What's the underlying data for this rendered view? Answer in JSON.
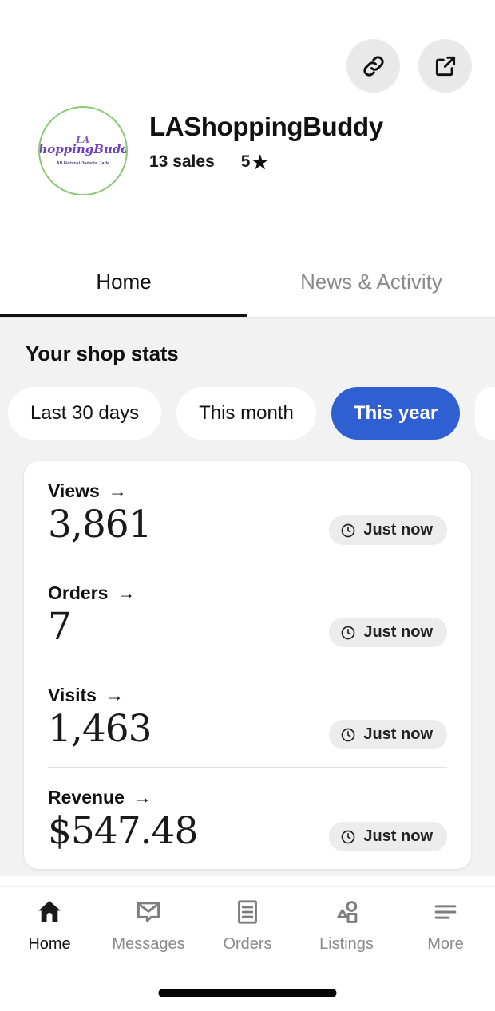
{
  "header": {
    "actions": [
      {
        "name": "link-icon",
        "label": "Copy shop link"
      },
      {
        "name": "external-link-icon",
        "label": "Open shop"
      }
    ],
    "logo": {
      "top_text": "LA",
      "name_text": "ShoppingBuddy",
      "sub_text": "All Natural Jadeite Jade",
      "border_color": "#8cc878",
      "text_color": "#6d3fc4"
    },
    "shop_name": "LAShoppingBuddy",
    "sales_text": "13 sales",
    "rating_value": "5",
    "rating_star": "★"
  },
  "tabs": [
    {
      "label": "Home",
      "active": true
    },
    {
      "label": "News & Activity",
      "active": false
    }
  ],
  "stats": {
    "title": "Your shop stats",
    "filters": [
      {
        "label": "Last 30 days",
        "selected": false
      },
      {
        "label": "This month",
        "selected": false
      },
      {
        "label": "This year",
        "selected": true
      },
      {
        "label": "",
        "selected": false
      }
    ],
    "selected_color": "#2f5fd0",
    "rows": [
      {
        "label": "Views",
        "arrow": "→",
        "value": "3,861",
        "time": "Just now"
      },
      {
        "label": "Orders",
        "arrow": "→",
        "value": "7",
        "time": "Just now"
      },
      {
        "label": "Visits",
        "arrow": "→",
        "value": "1,463",
        "time": "Just now"
      },
      {
        "label": "Revenue",
        "arrow": "→",
        "value": "$547.48",
        "time": "Just now"
      }
    ]
  },
  "bottom_nav": [
    {
      "label": "Home",
      "icon": "home-icon",
      "active": true
    },
    {
      "label": "Messages",
      "icon": "messages-icon",
      "active": false
    },
    {
      "label": "Orders",
      "icon": "orders-icon",
      "active": false
    },
    {
      "label": "Listings",
      "icon": "listings-icon",
      "active": false
    },
    {
      "label": "More",
      "icon": "menu-icon",
      "active": false
    }
  ]
}
